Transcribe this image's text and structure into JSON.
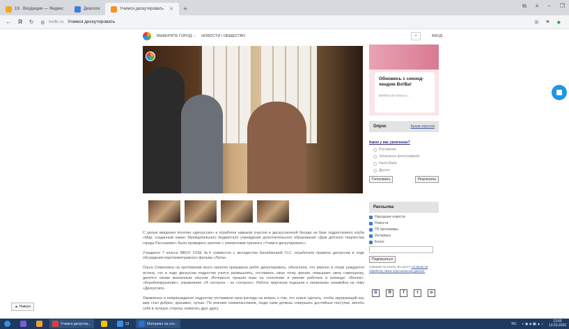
{
  "browser": {
    "tabs": [
      {
        "label": "19 · Входящие — Яндекс",
        "color": "#f2a71b",
        "active": false
      },
      {
        "label": "Диалоги",
        "color": "#3b7dd8",
        "active": false
      },
      {
        "label": "Учимся дискутировать",
        "color": "#f7941d",
        "active": true
      }
    ],
    "new_tab": "+",
    "address": {
      "host": "tvolk.ru",
      "title": "Учимся дискутировать"
    }
  },
  "site": {
    "city_select": "ВЫБЕРИТЕ ГОРОД",
    "nav": "НОВОСТИ / ОБЩЕСТВО",
    "login": "ВХОД"
  },
  "article": {
    "paragraphs": [
      "С целью введения понятия «дискуссия» и отработки навыков участия в дискуссионной беседе на базе подросткового клуба «Мир, созданный нами» Муниципального бюджетного учреждения дополнительного образования «Дом детского творчества города Рассказово» было проведено занятие с элементами тренинга «Учимся дискутировать».",
      "Учащиеся 7 класса МБОУ СОШ №4 совместно с методистом Балабановой О.С. отработали правила дискуссии в ходе обсуждения короткометражного фильма «Лела».",
      "Ольга Семеновна на протяжении всего занятия призывала ребят дискутировать, объясняла, что именно в споре рождается истина, что в ходе дискуссии подростки учатся размышлять, отстаивать свою точку зрения, повышают свою самооценку, делятся своим жизненным опытом. Интересно прошли игры на сплочение и умение работать в команде: «Волна», «Кораблекрушение», упражнение «Я согласен - не согласен». Ребята творчески подошли к написанию синквейна на тему «Дискуссия».",
      "Оживленно и непринужденно подростки отстаивали свои взгляды на вопрос о том, что нужно сделать, чтобы окружающий нас мир стал добрее, красивее, лучше. По мнению семиклассников, люди сами должны совершать достойные поступки, менять себя в лучшую сторону, помогать друг другу."
    ]
  },
  "ad": {
    "title": "Обновись с секонд-хендом Во!Ва!",
    "link": "tambov.sh-vova.ru →"
  },
  "poll": {
    "title": "Опрос",
    "archive": "Архив опросов",
    "question": "Какое у вас увлечение?",
    "options": [
      "Рисование",
      "Увлекаюсь фотографией",
      "Hand Made",
      "Другое"
    ],
    "vote": "Голосовать",
    "results": "Результаты"
  },
  "subscribe": {
    "title": "Рассылка",
    "items": [
      "Народные новости",
      "Новости",
      "ТВ программы",
      "Интервью",
      "Блоги"
    ],
    "button": "Подписаться",
    "note": "Нажимая на кнопку, Вы даете ",
    "note_link": "согласие на обработку своих персональных данных."
  },
  "social": [
    "В",
    "Я",
    "f",
    "t",
    "o"
  ],
  "back_button": "▲ Наверх",
  "taskbar": {
    "items": [
      {
        "label": "",
        "color": "#3a8ee6"
      },
      {
        "label": "",
        "color": "#7a5cd6"
      },
      {
        "label": "",
        "color": "#f0a030"
      },
      {
        "label": "Учимся дискутир...",
        "color": "#e53935"
      },
      {
        "label": "",
        "color": "#f2c200"
      },
      {
        "label": "13",
        "color": "#3a8ee6"
      },
      {
        "label": "Материал на сон...",
        "color": "#2e6fc9"
      }
    ],
    "tray_lang": "RU",
    "time": "13:56",
    "date": "13.03.2020"
  }
}
